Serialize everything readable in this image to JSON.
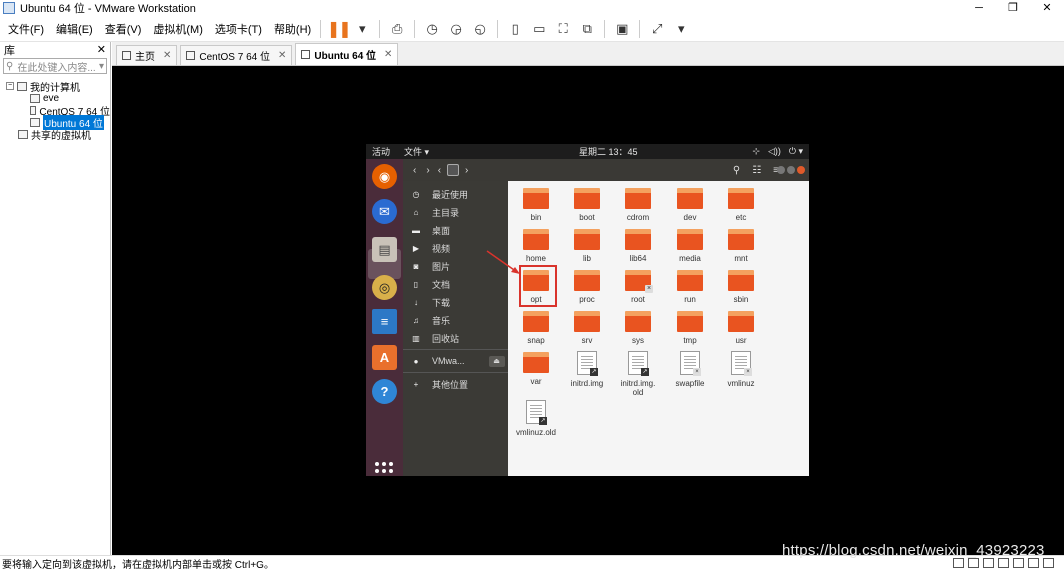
{
  "window": {
    "title": "Ubuntu 64 位 - VMware Workstation"
  },
  "menu": [
    "文件(F)",
    "编辑(E)",
    "查看(V)",
    "虚拟机(M)",
    "选项卡(T)",
    "帮助(H)"
  ],
  "library": {
    "title": "库",
    "search_placeholder": "在此处键入内容...",
    "tree": {
      "root": "我的计算机",
      "vms": [
        "eve",
        "CentOS 7 64 位",
        "Ubuntu 64 位"
      ],
      "shared": "共享的虚拟机"
    }
  },
  "tabs": [
    "主页",
    "CentOS 7 64 位",
    "Ubuntu 64 位"
  ],
  "ubuntu": {
    "topbar": {
      "activities": "活动",
      "files_menu": "文件 ▾",
      "clock": "星期二 13：45"
    },
    "sidebar": [
      "最近使用",
      "主目录",
      "桌面",
      "视频",
      "图片",
      "文档",
      "下载",
      "音乐",
      "回收站",
      "VMwa...",
      "其他位置"
    ],
    "items": [
      "bin",
      "boot",
      "cdrom",
      "dev",
      "etc",
      "home",
      "lib",
      "lib64",
      "media",
      "mnt",
      "opt",
      "proc",
      "root",
      "run",
      "sbin",
      "snap",
      "srv",
      "sys",
      "tmp",
      "usr",
      "var",
      "initrd.img",
      "initrd.img.\nold",
      "swapfile",
      "vmlinuz",
      "vmlinuz.old"
    ]
  },
  "status": {
    "message": "要将输入定向到该虚拟机，请在虚拟机内部单击或按 Ctrl+G。"
  },
  "watermark": "https://blog.csdn.net/weixin_43923223",
  "colors": {
    "accent": "#e95420",
    "dock": "#4a2c3a",
    "highlight": "#d9332c"
  }
}
